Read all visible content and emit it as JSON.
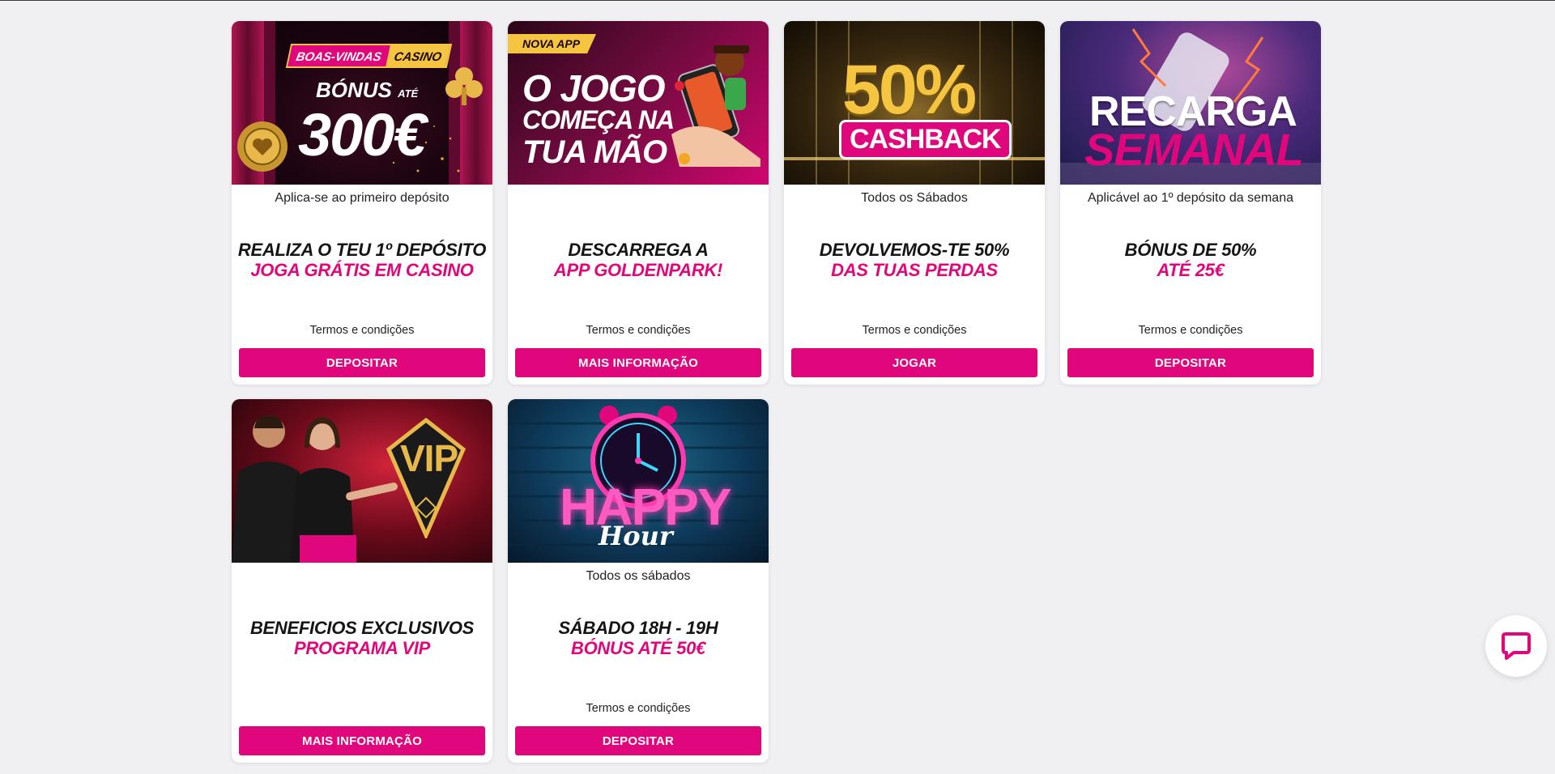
{
  "promotions": [
    {
      "banner": {
        "ribbon_left": "BOAS-VINDAS",
        "ribbon_right": "CASINO",
        "line1": "BÓNUS",
        "line1_small": "ATÉ",
        "line2": "300€"
      },
      "subtitle": "Aplica-se ao primeiro depósito",
      "headline_line1": "REALIZA O TEU 1º DEPÓSITO",
      "headline_line2": "JOGA GRÁTIS EM CASINO",
      "terms": "Termos e condições",
      "button": "DEPOSITAR"
    },
    {
      "banner": {
        "badge": "NOVA APP",
        "line1": "O JOGO",
        "line2": "COMEÇA NA",
        "line3": "TUA MÃO"
      },
      "subtitle": "",
      "headline_line1": "DESCARREGA A",
      "headline_line2": "APP GOLDENPARK!",
      "terms": "Termos e condições",
      "button": "MAIS INFORMAÇÃO"
    },
    {
      "banner": {
        "line1": "50%",
        "line2": "CASHBACK"
      },
      "subtitle": "Todos os Sábados",
      "headline_line1": "DEVOLVEMOS-TE 50%",
      "headline_line2": "DAS TUAS PERDAS",
      "terms": "Termos e condições",
      "button": "JOGAR"
    },
    {
      "banner": {
        "line1": "RECARGA",
        "line2": "SEMANAL"
      },
      "subtitle": "Aplicável ao 1º depósito da semana",
      "headline_line1": "BÓNUS DE 50%",
      "headline_line2": "ATÉ 25€",
      "terms": "Termos e condições",
      "button": "DEPOSITAR"
    },
    {
      "banner": {
        "line1": "VIP"
      },
      "subtitle": "",
      "headline_line1": "BENEFICIOS EXCLUSIVOS",
      "headline_line2": "PROGRAMA VIP",
      "terms": "",
      "button": "MAIS INFORMAÇÃO"
    },
    {
      "banner": {
        "line1": "HAPPY",
        "line2": "Hour"
      },
      "subtitle": "Todos os sábados",
      "headline_line1": "SÁBADO 18H - 19H",
      "headline_line2": "BÓNUS ATÉ 50€",
      "terms": "Termos e condições",
      "button": "DEPOSITAR"
    }
  ],
  "colors": {
    "accent": "#e0077d",
    "page_bg": "#f0f0f2",
    "card_bg": "#ffffff",
    "text_dark": "#151515"
  },
  "chat": {
    "icon": "chat-bubble-icon"
  }
}
